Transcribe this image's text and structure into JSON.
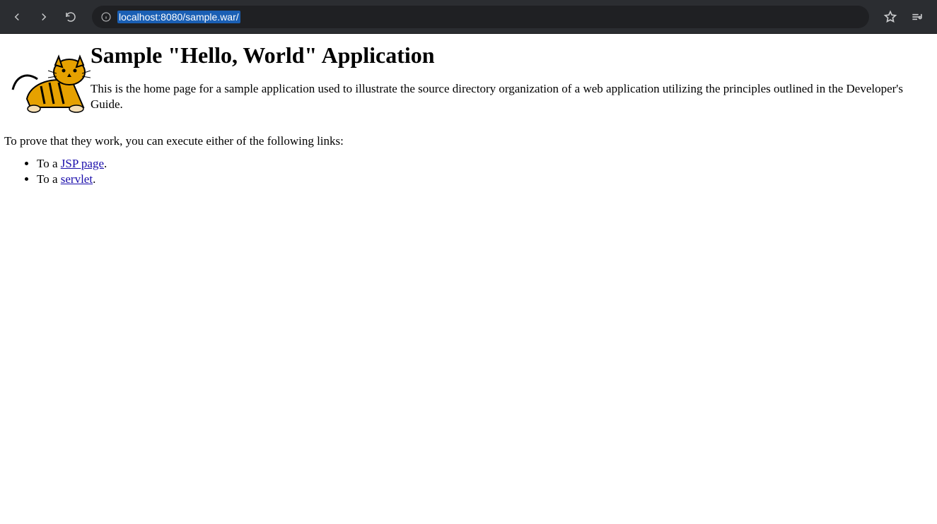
{
  "browser": {
    "url": "localhost:8080/sample.war/"
  },
  "page": {
    "heading": "Sample \"Hello, World\" Application",
    "intro": "This is the home page for a sample application used to illustrate the source directory organization of a web application utilizing the principles outlined in the Developer's Guide.",
    "prove_text": "To prove that they work, you can execute either of the following links:",
    "links": [
      {
        "prefix": "To a ",
        "text": "JSP page",
        "suffix": "."
      },
      {
        "prefix": "To a ",
        "text": "servlet",
        "suffix": "."
      }
    ]
  }
}
